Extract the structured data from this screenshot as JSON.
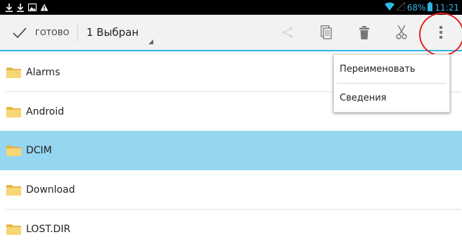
{
  "status_bar": {
    "left_icons": [
      "download-icon",
      "download-icon",
      "image-icon",
      "warning-icon"
    ],
    "battery": "68%",
    "time": "11:21",
    "accent_color": "#33b5e5"
  },
  "action_bar": {
    "done_label": "ГОТОВО",
    "selected_label": "1 Выбран",
    "actions": [
      "share-icon",
      "copy-icon",
      "delete-icon",
      "cut-icon",
      "overflow-menu-icon"
    ],
    "underline_color": "#33b5e5"
  },
  "files": [
    {
      "name": "Alarms",
      "icon": "folder-icon",
      "selected": false
    },
    {
      "name": "Android",
      "icon": "folder-icon",
      "selected": false
    },
    {
      "name": "DCIM",
      "icon": "folder-icon",
      "selected": true
    },
    {
      "name": "Download",
      "icon": "folder-icon",
      "selected": false
    },
    {
      "name": "LOST.DIR",
      "icon": "folder-icon",
      "selected": false
    }
  ],
  "popup_menu": {
    "items": [
      "Переименовать",
      "Сведения"
    ]
  },
  "colors": {
    "selected_row": "#95d6f0",
    "annotation": "#e4221c"
  }
}
